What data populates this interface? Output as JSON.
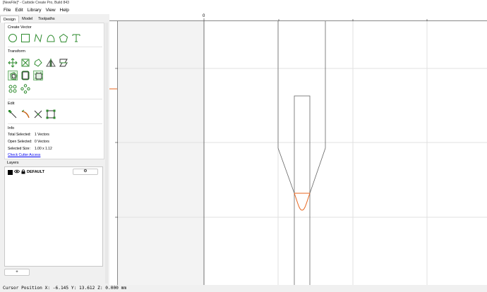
{
  "window": {
    "title": "[NewFile]* - Carbide Create Pro, Build 843"
  },
  "menu": {
    "items": [
      "File",
      "Edit",
      "Library",
      "View",
      "Help"
    ]
  },
  "tabs": [
    "Design",
    "Model",
    "Toolpaths"
  ],
  "design": {
    "create_vector": {
      "title": "Create Vector",
      "icons": [
        "circle-icon",
        "rectangle-icon",
        "polyline-icon",
        "curve-icon",
        "polygon-icon",
        "text-icon"
      ]
    },
    "transform": {
      "title": "Transform",
      "icons": [
        "move-icon",
        "scale-icon",
        "rotate-icon",
        "mirror-icon",
        "align-icon",
        "offset-icon",
        "boolean-icon",
        "fillet-icon",
        "array-icon",
        "circular-array-icon"
      ]
    },
    "edit": {
      "title": "Edit",
      "icons": [
        "node-edit-icon",
        "curve-edit-icon",
        "trim-icon",
        "bounding-box-icon"
      ]
    },
    "info": {
      "title": "Info",
      "total_selected_label": "Total Selected:",
      "total_selected_value": "1 Vectors",
      "open_selected_label": "Open Selected:",
      "open_selected_value": "0 Vectors",
      "selected_size_label": "Selected Size:",
      "selected_size_value": "1.00 x 1.12",
      "check_cutter_link": "Check Cutter Access"
    },
    "layers": {
      "title": "Layers",
      "items": [
        {
          "name": "DEFAULT",
          "color": "#000000"
        }
      ],
      "add_label": "+"
    }
  },
  "ruler": {
    "top_origin_label": "0"
  },
  "colors": {
    "accent": "#2e8b2e",
    "selection": "#e8661e",
    "grid": "#e0e0e0",
    "vector": "#666666"
  },
  "status": {
    "cursor_text": "Cursor Position X: -6.145 Y: 13.612 Z: 0.000 mm"
  }
}
